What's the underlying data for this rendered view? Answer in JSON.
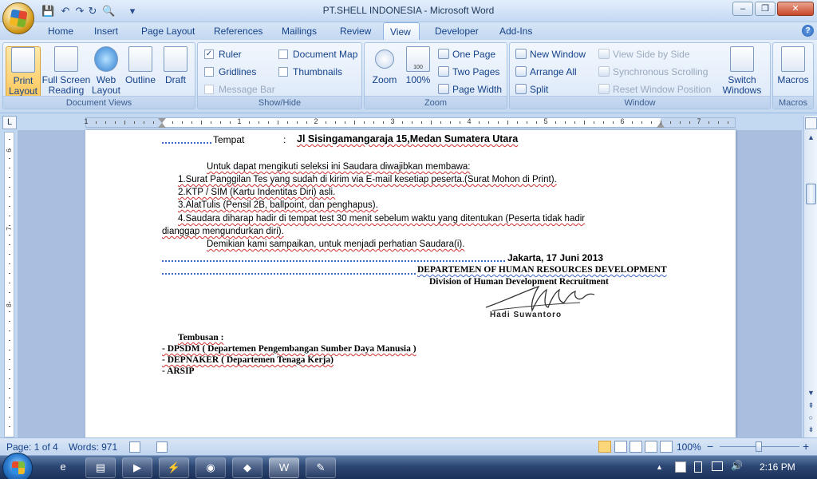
{
  "window": {
    "title": "PT.SHELL INDONESIA - Microsoft Word",
    "minimize": "–",
    "restore": "❐",
    "close": "✕"
  },
  "tabs": [
    "Home",
    "Insert",
    "Page Layout",
    "References",
    "Mailings",
    "Review",
    "View",
    "Developer",
    "Add-Ins"
  ],
  "active_tab": "View",
  "ribbon": {
    "document_views": {
      "label": "Document Views",
      "print_layout": "Print Layout",
      "full_screen_reading": "Full Screen Reading",
      "web_layout": "Web Layout",
      "outline": "Outline",
      "draft": "Draft"
    },
    "show_hide": {
      "label": "Show/Hide",
      "ruler": "Ruler",
      "gridlines": "Gridlines",
      "message_bar": "Message Bar",
      "document_map": "Document Map",
      "thumbnails": "Thumbnails",
      "ruler_checked": true,
      "check_mark": "✓"
    },
    "zoom": {
      "label": "Zoom",
      "zoom": "Zoom",
      "hundred": "100%",
      "one_page": "One Page",
      "two_pages": "Two Pages",
      "page_width": "Page Width",
      "icon_text": "100"
    },
    "window": {
      "label": "Window",
      "new_window": "New Window",
      "arrange_all": "Arrange All",
      "split": "Split",
      "view_side_by_side": "View Side by Side",
      "synchronous_scrolling": "Synchronous Scrolling",
      "reset_window_position": "Reset Window Position",
      "switch_windows": "Switch Windows"
    },
    "macros": {
      "label": "Macros",
      "macros": "Macros"
    }
  },
  "ruler": {
    "corner": "L",
    "h_numbers": [
      "1",
      "1",
      "2",
      "3",
      "4",
      "5",
      "6",
      "7"
    ],
    "v_numbers": [
      "6",
      "7",
      "8"
    ]
  },
  "document": {
    "tempat_label": "Tempat",
    "tempat_colon": ":",
    "tempat_value": "Jl Sisingamangaraja 15,Medan Sumatera Utara",
    "intro": "Untuk dapat mengikuti seleksi ini Saudara diwajibkan  membawa:",
    "item1": "1.Surat Panggilan  Tes yang  sudah di kirim via E-mail  kesetiap  peserta.(Surat Mohon di Print).",
    "item2": "2.KTP / SIM (Kartu Indentitas Diri) asli.",
    "item3": "3.AlatTulis (Pensil 2B, ballpoint,  dan penghapus).",
    "item4a": "4.Saudara  diharap hadir di tempat test 30 menit sebelum waktu yang ditentukan (Peserta tidak hadir",
    "item4b": "dianggap  mengundurkan diri).",
    "closing": "Demikian  kami sampaikan,  untuk menjadi  perhatian Saudara(i).",
    "date": "Jakarta, 17 Juni  2013",
    "department": "DEPARTEMEN OF HUMAN RESOURCES DEVELOPMENT",
    "division": "Division of Human Development  Recruitment",
    "signatory": "Hadi Suwantoro",
    "tembusan": "Tembusan :",
    "cc1": "- DPSDM  ( Departemen  Pengembangan  Sumber Daya  Manusia )",
    "cc2": "- DEPNAKER ( Departemen Tenaga Kerja)",
    "cc3": "- ARSIP"
  },
  "status": {
    "page": "Page: 1 of 4",
    "words": "Words: 971",
    "zoom": "100%",
    "zoom_minus": "−",
    "zoom_plus": "+"
  },
  "scrollbar": {
    "up": "▲",
    "down": "▼",
    "prev": "⇞",
    "browse": "○",
    "next": "⇟"
  },
  "taskbar": {
    "time": "2:16 PM",
    "tray_arrow": "▲"
  },
  "colors": {
    "ribbon_accent": "#15428b",
    "squiggle_red": "#d03030",
    "squiggle_blue": "#3b66c9"
  }
}
